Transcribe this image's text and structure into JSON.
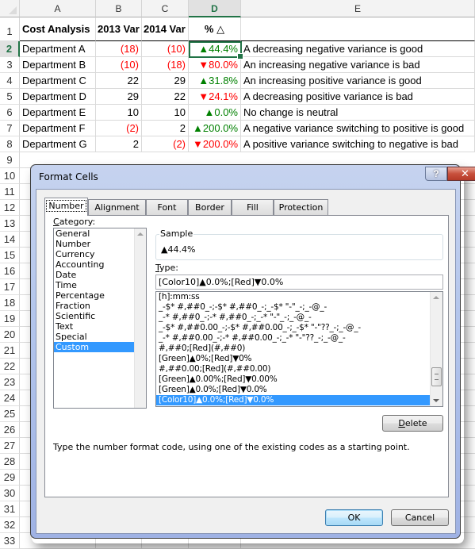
{
  "spreadsheet": {
    "columns": [
      "A",
      "B",
      "C",
      "D",
      "E"
    ],
    "selected_column": "D",
    "selected_row": "2",
    "row_numbers": [
      "1",
      "2",
      "3",
      "4",
      "5",
      "6",
      "7",
      "8",
      "9",
      "10",
      "11",
      "12",
      "13",
      "14",
      "15",
      "16",
      "17",
      "18",
      "19",
      "20",
      "21",
      "22",
      "23",
      "24",
      "25",
      "26",
      "27",
      "28",
      "29",
      "30",
      "31",
      "32",
      "33"
    ],
    "headers": {
      "a": "Cost Analysis",
      "b": "2013 Var",
      "c": "2014 Var",
      "d": "% △"
    },
    "rows": [
      {
        "dept": "Department A",
        "v2013": "(18)",
        "v2013_neg": true,
        "v2014": "(10)",
        "v2014_neg": true,
        "dir": "▲",
        "pct": "44.4%",
        "trend": "up",
        "note": "A decreasing negative variance is good"
      },
      {
        "dept": "Department B",
        "v2013": "(10)",
        "v2013_neg": true,
        "v2014": "(18)",
        "v2014_neg": true,
        "dir": "▼",
        "pct": "80.0%",
        "trend": "down",
        "note": "An increasing negative variance is bad"
      },
      {
        "dept": "Department C",
        "v2013": "22",
        "v2013_neg": false,
        "v2014": "29",
        "v2014_neg": false,
        "dir": "▲",
        "pct": "31.8%",
        "trend": "up",
        "note": "An increasing positive variance is good"
      },
      {
        "dept": "Department D",
        "v2013": "29",
        "v2013_neg": false,
        "v2014": "22",
        "v2014_neg": false,
        "dir": "▼",
        "pct": "24.1%",
        "trend": "down",
        "note": "A decreasing positive variance is bad"
      },
      {
        "dept": "Department E",
        "v2013": "10",
        "v2013_neg": false,
        "v2014": "10",
        "v2014_neg": false,
        "dir": "▲",
        "pct": "0.0%",
        "trend": "up",
        "note": "No change is neutral"
      },
      {
        "dept": "Department F",
        "v2013": "(2)",
        "v2013_neg": true,
        "v2014": "2",
        "v2014_neg": false,
        "dir": "▲",
        "pct": "200.0%",
        "trend": "up",
        "note": "A negative variance switching to positive is good"
      },
      {
        "dept": "Department G",
        "v2013": "2",
        "v2013_neg": false,
        "v2014": "(2)",
        "v2014_neg": true,
        "dir": "▼",
        "pct": "200.0%",
        "trend": "down",
        "note": "A positive variance switching to negative is bad"
      }
    ],
    "colors": {
      "up": "#008000",
      "down": "#ff0000",
      "negative": "#ff0000",
      "selection": "#217346"
    }
  },
  "dialog": {
    "title": "Format Cells",
    "help_label": "?",
    "close_label": "✕",
    "tabs": [
      "Number",
      "Alignment",
      "Font",
      "Border",
      "Fill",
      "Protection"
    ],
    "active_tab": "Number",
    "category_label_u": "C",
    "category_label_rest": "ategory:",
    "categories": [
      "General",
      "Number",
      "Currency",
      "Accounting",
      "Date",
      "Time",
      "Percentage",
      "Fraction",
      "Scientific",
      "Text",
      "Special",
      "Custom"
    ],
    "selected_category": "Custom",
    "sample_label": "Sample",
    "sample_value": "▲44.4%",
    "type_label_u": "T",
    "type_label_rest": "ype:",
    "type_value": "[Color10]▲0.0%;[Red]▼0.0%",
    "formats": [
      "[h]:mm:ss",
      "_-$* #,##0_-;-$* #,##0_-;_-$* \"-\"_-;_-@_-",
      "_-* #,##0_-;-* #,##0_-;_-* \"-\"_-;_-@_-",
      "_-$* #,##0.00_-;-$* #,##0.00_-;_-$* \"-\"??_-;_-@_-",
      "_-* #,##0.00_-;-* #,##0.00_-;_-* \"-\"??_-;_-@_-",
      "#,##0;[Red](#,##0)",
      "[Green]▲0%;[Red]▼0%",
      "#,##0.00;[Red](#,##0.00)",
      "[Green]▲0.00%;[Red]▼0.00%",
      "[Green]▲0.0%;[Red]▼0.0%",
      "[Color10]▲0.0%;[Red]▼0.0%"
    ],
    "selected_format": "[Color10]▲0.0%;[Red]▼0.0%",
    "delete_label_u": "D",
    "delete_label_rest": "elete",
    "hint": "Type the number format code, using one of the existing codes as a starting point.",
    "ok_label": "OK",
    "cancel_label": "Cancel"
  }
}
